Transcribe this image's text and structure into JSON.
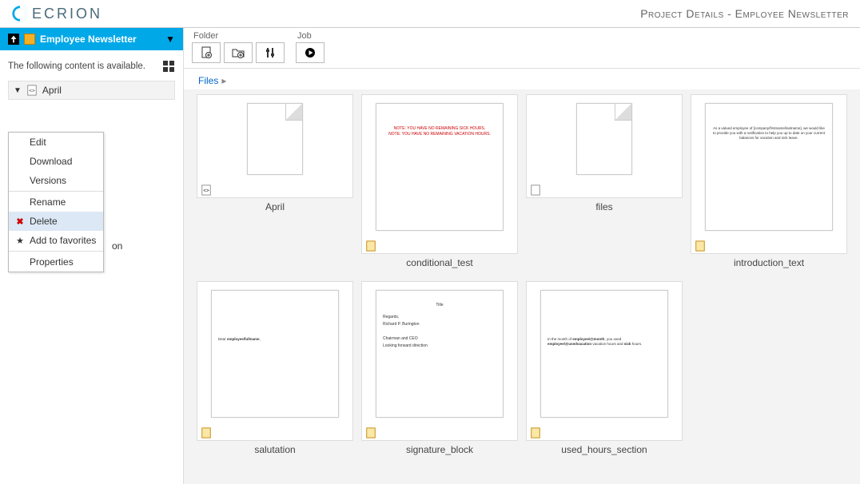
{
  "brand": {
    "name": "ECRION"
  },
  "page_title": "Project Details - Employee Newsletter",
  "sidebar": {
    "project_name": "Employee Newsletter",
    "content_message": "The following content is available.",
    "tree_item": "April",
    "peek_item": "on"
  },
  "context_menu": {
    "edit": "Edit",
    "download": "Download",
    "versions": "Versions",
    "rename": "Rename",
    "delete": "Delete",
    "add_favorites": "Add to favorites",
    "properties": "Properties"
  },
  "toolbar": {
    "folder_label": "Folder",
    "job_label": "Job"
  },
  "breadcrumb": {
    "root": "Files"
  },
  "files": [
    {
      "name": "April",
      "type": "xml"
    },
    {
      "name": "conditional_test",
      "type": "doc"
    },
    {
      "name": "files",
      "type": "txt"
    },
    {
      "name": "introduction_text",
      "type": "doc"
    },
    {
      "name": "salutation",
      "type": "doc"
    },
    {
      "name": "signature_block",
      "type": "doc"
    },
    {
      "name": "used_hours_section",
      "type": "doc"
    }
  ]
}
